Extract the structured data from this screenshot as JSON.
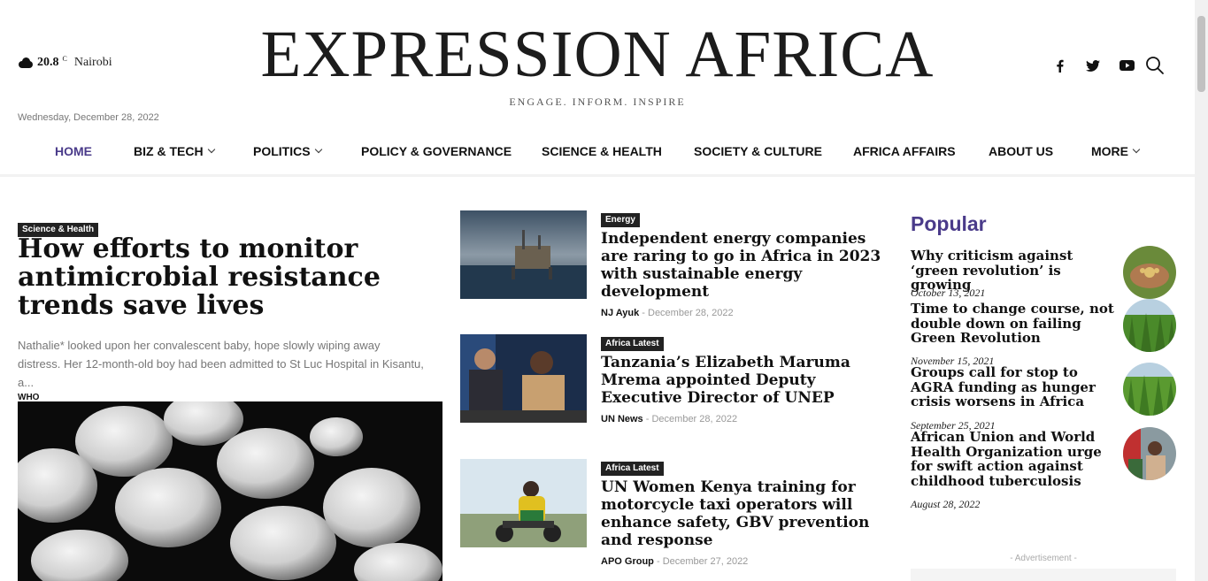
{
  "header": {
    "weather_icon": "cloud-icon",
    "temperature": "20.8",
    "unit": "C",
    "city": "Nairobi",
    "date": "Wednesday, December 28, 2022",
    "logo": "EXPRESSION AFRICA",
    "tagline": "ENGAGE. INFORM. INSPIRE",
    "social": [
      "facebook-icon",
      "twitter-icon",
      "youtube-icon"
    ],
    "search_icon": "search-icon"
  },
  "nav": {
    "items": [
      {
        "label": "HOME",
        "active": true
      },
      {
        "label": "BIZ & TECH",
        "dropdown": true
      },
      {
        "label": "POLITICS",
        "dropdown": true
      },
      {
        "label": "POLICY & GOVERNANCE"
      },
      {
        "label": "SCIENCE & HEALTH"
      },
      {
        "label": "SOCIETY & CULTURE"
      },
      {
        "label": "AFRICA AFFAIRS"
      },
      {
        "label": "ABOUT US"
      },
      {
        "label": "MORE",
        "dropdown": true
      }
    ],
    "active_color": "#4a3b8a"
  },
  "feature": {
    "category": "Science & Health",
    "title": "How efforts to monitor antimicrobial resistance trends save lives",
    "excerpt": "Nathalie* looked upon her convalescent baby, hope slowly wiping away distress. Her 12-month-old boy had been admitted to St Luc Hospital in Kisantu, a...",
    "author": "WHO"
  },
  "articles": [
    {
      "category": "Energy",
      "title": "Independent energy companies are raring to go in Africa in 2023 with sustainable energy development",
      "author": "NJ Ayuk",
      "date": "December 28, 2022"
    },
    {
      "category": "Africa Latest",
      "title": "Tanzania’s Elizabeth Maruma Mrema appointed Deputy Executive Director of UNEP",
      "author": "UN News",
      "date": "December 28, 2022"
    },
    {
      "category": "Africa Latest",
      "title": "UN Women Kenya training for motorcycle taxi operators will enhance safety, GBV prevention and response",
      "author": "APO Group",
      "date": "December 27, 2022"
    }
  ],
  "popular": {
    "heading": "Popular",
    "items": [
      {
        "title": "Why criticism against ‘green revolution’ is growing",
        "date": "October 13, 2021"
      },
      {
        "title": "Time to change course, not double down on failing Green Revolution",
        "date": "November 15, 2021"
      },
      {
        "title": "Groups call for stop to AGRA funding as hunger crisis worsens in Africa",
        "date": "September 25, 2021"
      },
      {
        "title": "African Union and World Health Organization urge for swift action against childhood tuberculosis",
        "date": "August 28, 2022"
      }
    ]
  },
  "advertisement_label": "- Advertisement -",
  "separator": "-"
}
